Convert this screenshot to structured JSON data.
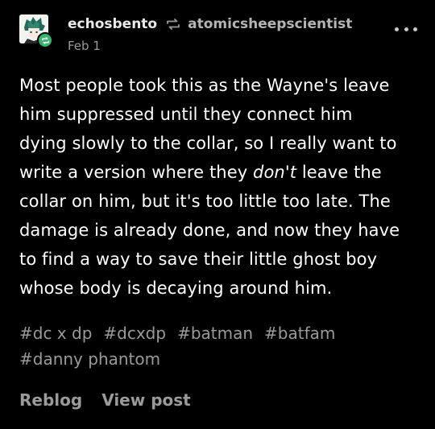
{
  "post": {
    "author": "echosbento",
    "reblogged_from": "atomicsheepscientist",
    "date": "Feb 1",
    "body": {
      "line1": "Most people took this as the Wayne's leave",
      "line2": "him suppressed until they connect him",
      "line3": "dying slowly to the collar, so I really want to",
      "line4_before": "write a version where they ",
      "line4_em": "don't",
      "line4_after": " leave the",
      "line5": "collar on him, but it's too little too late. The",
      "line6": "damage is already done, and now they have",
      "line7": "to find a way to save their little ghost boy",
      "line8": "whose body is decaying around him."
    },
    "tags": [
      "#dc x dp",
      "#dcxdp",
      "#batman",
      "#batfam",
      "#danny phantom"
    ],
    "actions": {
      "reblog": "Reblog",
      "view_post": "View post"
    }
  },
  "icons": {
    "avatar": "avatar",
    "reblog_badge": "reblog-icon",
    "reblog_arrow": "reblog-arrows-icon",
    "more": "more-dots-icon"
  },
  "colors": {
    "background": "#000000",
    "text": "#ffffff",
    "muted": "#9a9a9a",
    "badge": "#2fba6a"
  }
}
